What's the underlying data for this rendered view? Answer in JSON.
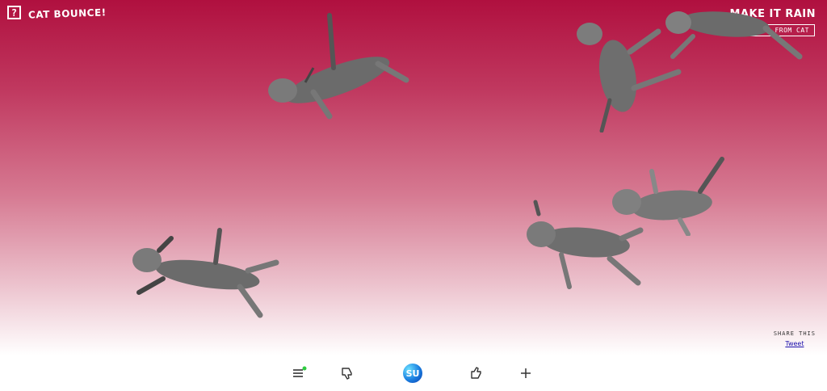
{
  "header": {
    "logo_symbol": "?",
    "logo_text": "CAT BOUNCE!",
    "rain_label": "MAKE IT RAIN",
    "message_label": "✉ MESSAGE FROM CAT"
  },
  "share": {
    "label": "SHARE THIS",
    "tweet_label": "Tweet"
  },
  "toolbar": {
    "stumble_label": "SU",
    "items": [
      "menu-icon",
      "thumbs-down-icon",
      "stumbleupon-icon",
      "thumbs-up-icon",
      "plus-icon"
    ]
  },
  "colors": {
    "top": "#b0103f",
    "bottom": "#ffffff",
    "notification_dot": "#2ecc40"
  }
}
